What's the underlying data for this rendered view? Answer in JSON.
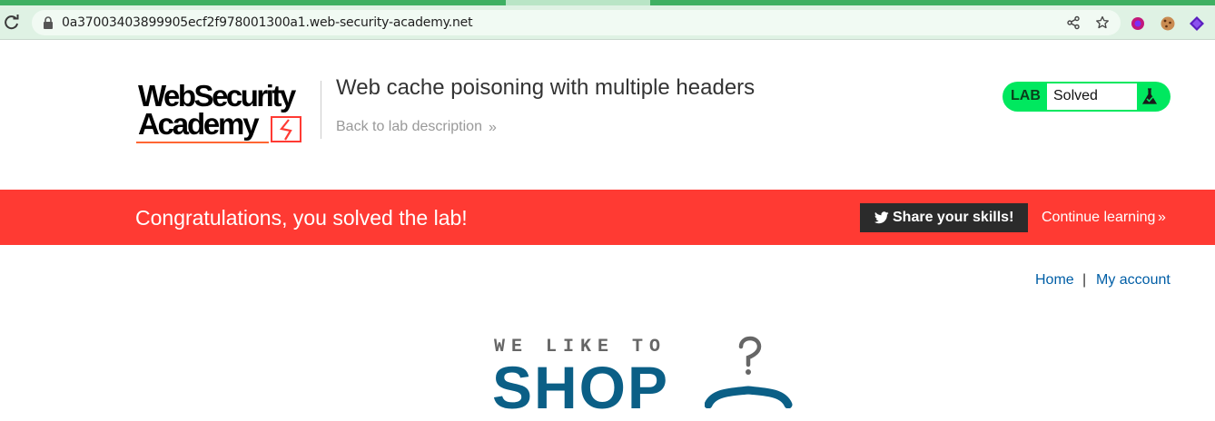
{
  "browser": {
    "url": "0a37003403899905ecf2f978001300a1.web-security-academy.net",
    "icons": [
      "reload-icon",
      "lock-icon",
      "share-icon",
      "bookmark-star-icon",
      "extension-icon",
      "cookie-icon",
      "extension-diamond-icon"
    ]
  },
  "header": {
    "logo_line1": "WebSecurity",
    "logo_line2": "Academy",
    "lab_title": "Web cache poisoning with multiple headers",
    "back_link": "Back to lab description",
    "back_chevron": "»",
    "lab_badge": "LAB",
    "lab_status": "Solved"
  },
  "banner": {
    "message": "Congratulations, you solved the lab!",
    "share_label": "Share your skills!",
    "continue_label": "Continue learning",
    "continue_chevron": "»"
  },
  "nav": {
    "home": "Home",
    "separator": "|",
    "account": "My account"
  },
  "shop": {
    "tagline": "WE LIKE TO",
    "word": "SHOP"
  },
  "colors": {
    "banner": "#ff3a33",
    "lab_badge": "#00e85f",
    "link": "#005ea6",
    "shop": "#0b5f86"
  }
}
